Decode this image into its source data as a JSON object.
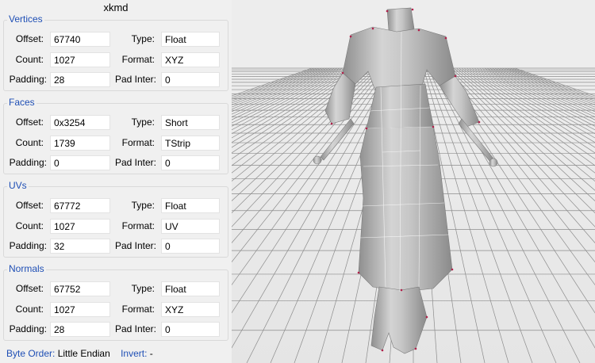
{
  "window": {
    "title": "xkmd"
  },
  "groups": [
    {
      "title": "Vertices",
      "offset_label": "Offset:",
      "offset": "67740",
      "count_label": "Count:",
      "count": "1027",
      "padding_label": "Padding:",
      "padding": "28",
      "type_label": "Type:",
      "type": "Float",
      "format_label": "Format:",
      "format": "XYZ",
      "padinter_label": "Pad Inter:",
      "padinter": "0"
    },
    {
      "title": "Faces",
      "offset_label": "Offset:",
      "offset": "0x3254",
      "count_label": "Count:",
      "count": "1739",
      "padding_label": "Padding:",
      "padding": "0",
      "type_label": "Type:",
      "type": "Short",
      "format_label": "Format:",
      "format": "TStrip",
      "padinter_label": "Pad Inter:",
      "padinter": "0"
    },
    {
      "title": "UVs",
      "offset_label": "Offset:",
      "offset": "67772",
      "count_label": "Count:",
      "count": "1027",
      "padding_label": "Padding:",
      "padding": "32",
      "type_label": "Type:",
      "type": "Float",
      "format_label": "Format:",
      "format": "UV",
      "padinter_label": "Pad Inter:",
      "padinter": "0"
    },
    {
      "title": "Normals",
      "offset_label": "Offset:",
      "offset": "67752",
      "count_label": "Count:",
      "count": "1027",
      "padding_label": "Padding:",
      "padding": "28",
      "type_label": "Type:",
      "type": "Float",
      "format_label": "Format:",
      "format": "XYZ",
      "padinter_label": "Pad Inter:",
      "padinter": "0"
    }
  ],
  "footer": {
    "byte_order_label": "Byte Order:",
    "byte_order": "Little Endian",
    "invert_label": "Invert:",
    "invert": "-"
  },
  "colors": {
    "group_title": "#1f4fb5",
    "panel_bg": "#f0f0f0",
    "viewport_bg": "#ececec",
    "grid_line": "#8c8c8c",
    "model": "#bdbdbd"
  }
}
